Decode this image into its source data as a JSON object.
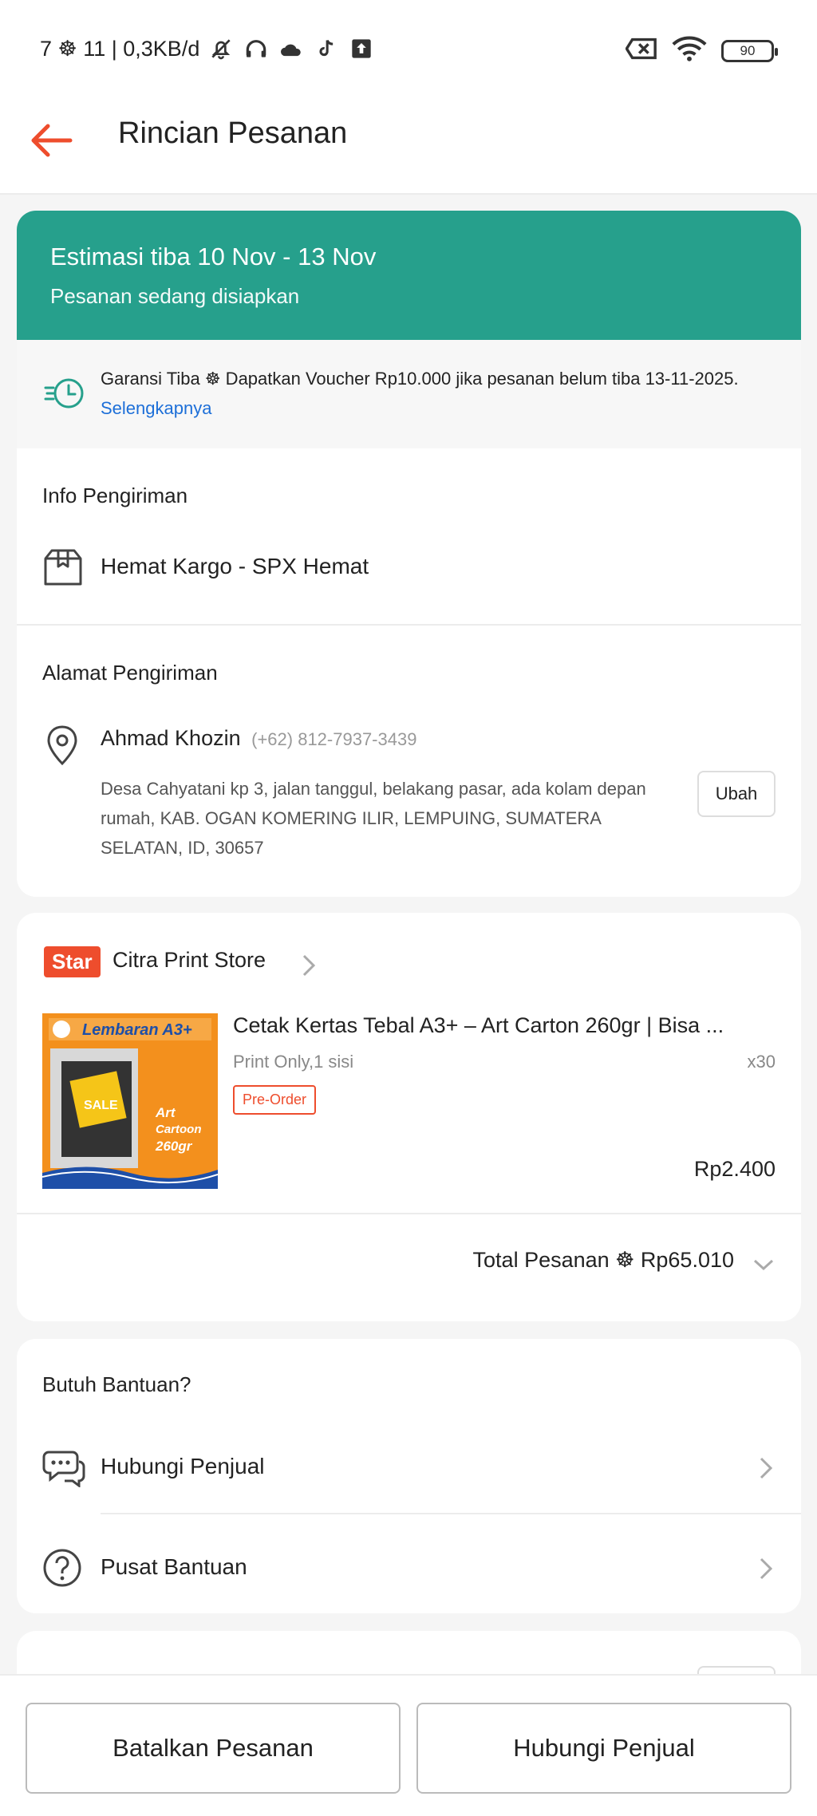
{
  "status_bar": {
    "left_text": "7 ☸ 11 | 0,3KB/d",
    "battery": "90",
    "icons": [
      "bell-off-icon",
      "headphones-icon",
      "cloud-icon",
      "tiktok-icon",
      "upload-icon",
      "sim-off-icon",
      "wifi-icon",
      "battery-icon"
    ]
  },
  "header": {
    "title": "Rincian Pesanan",
    "accent": "#ee4d2d"
  },
  "estimate": {
    "title": "Estimasi tiba 10 Nov - 13 Nov",
    "subtitle": "Pesanan sedang disiapkan",
    "color": "#26a08c"
  },
  "guarantee": {
    "text": "Garansi Tiba ☸ Dapatkan Voucher Rp10.000 jika pesanan belum tiba 13-11-2025.",
    "link": "Selengkapnya"
  },
  "shipping": {
    "info_title": "Info Pengiriman",
    "courier": "Hemat Kargo - SPX Hemat",
    "address_title": "Alamat Pengiriman",
    "name": "Ahmad Khozin",
    "phone": "(+62) 812-7937-3439",
    "address": "Desa Cahyatani kp 3, jalan tanggul, belakang pasar, ada kolam depan rumah, KAB. OGAN KOMERING ILIR, LEMPUING, SUMATERA SELATAN, ID, 30657",
    "edit_button": "Ubah"
  },
  "store": {
    "badge": "Star",
    "name": "Citra Print Store",
    "product": {
      "title": "Cetak Kertas Tebal A3+ – Art Carton 260gr | Bisa ...",
      "variant": "Print Only,1 sisi",
      "qty": "x30",
      "tag": "Pre-Order",
      "price": "Rp2.400",
      "thumb_title": "Lembaran A3+",
      "thumb_sale": "SALE",
      "thumb_l1": "Art",
      "thumb_l2": "Cartoon",
      "thumb_l3": "260gr"
    },
    "total_label": "Total Pesanan ☸",
    "total_value": "Rp65.010"
  },
  "help": {
    "title": "Butuh Bantuan?",
    "items": [
      {
        "label": "Hubungi Penjual"
      },
      {
        "label": "Pusat Bantuan"
      }
    ]
  },
  "actions": {
    "cancel": "Batalkan Pesanan",
    "contact": "Hubungi Penjual"
  }
}
